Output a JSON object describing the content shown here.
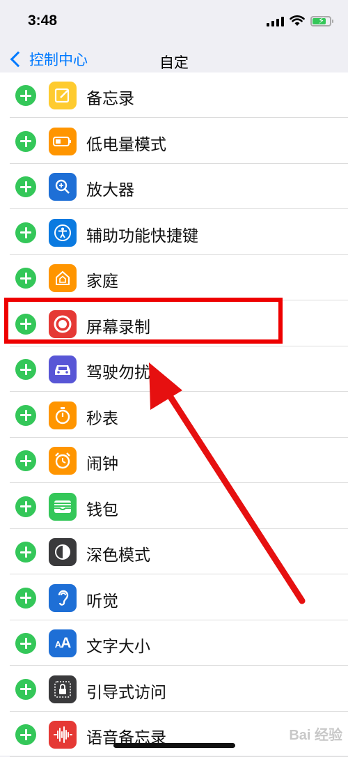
{
  "status_bar": {
    "time": "3:48"
  },
  "nav": {
    "back_label": "控制中心",
    "title": "自定"
  },
  "rows": [
    {
      "label": "备忘录",
      "icon": "notes-icon",
      "color": "#fecb2f"
    },
    {
      "label": "低电量模式",
      "icon": "battery-icon",
      "color": "#ff9500"
    },
    {
      "label": "放大器",
      "icon": "magnifier-icon",
      "color": "#1e6fd6"
    },
    {
      "label": "辅助功能快捷键",
      "icon": "accessibility-icon",
      "color": "#0a7ae0"
    },
    {
      "label": "家庭",
      "icon": "home-icon",
      "color": "#ff9500"
    },
    {
      "label": "屏幕录制",
      "icon": "screen-recording-icon",
      "color": "#e53935"
    },
    {
      "label": "驾驶勿扰",
      "icon": "car-icon",
      "color": "#5856d6"
    },
    {
      "label": "秒表",
      "icon": "stopwatch-icon",
      "color": "#ff9500"
    },
    {
      "label": "闹钟",
      "icon": "alarm-icon",
      "color": "#ff9500"
    },
    {
      "label": "钱包",
      "icon": "wallet-icon",
      "color": "#34c759"
    },
    {
      "label": "深色模式",
      "icon": "dark-mode-icon",
      "color": "#3a3a3c"
    },
    {
      "label": "听觉",
      "icon": "ear-icon",
      "color": "#1e6fd6"
    },
    {
      "label": "文字大小",
      "icon": "text-size-icon",
      "color": "#1e6fd6"
    },
    {
      "label": "引导式访问",
      "icon": "lock-icon",
      "color": "#3a3a3c"
    },
    {
      "label": "语音备忘录",
      "icon": "waveform-icon",
      "color": "#e53935"
    }
  ],
  "watermark": "Bai 经验"
}
